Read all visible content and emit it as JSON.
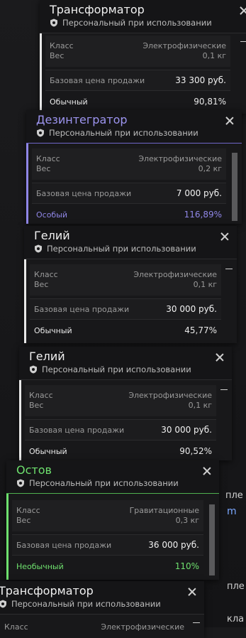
{
  "cards": [
    {
      "title": "Трансформатор",
      "subtitle": "Персональный при использовании",
      "class_label": "Класс",
      "class_value": "Электрофизические",
      "weight_label": "Вес",
      "weight_value": "0,1 кг",
      "price_label": "Базовая цена продажи",
      "price_value": "33 300 руб.",
      "quality_label": "Обычный",
      "quality_value": "90,81%",
      "accent": "#e8e8e8",
      "quality_color": "#e8e8e8"
    },
    {
      "title": "Дезинтегратор",
      "subtitle": "Персональный при использовании",
      "class_label": "Класс",
      "class_value": "Электрофизические",
      "weight_label": "Вес",
      "weight_value": "0,2 кг",
      "price_label": "Базовая цена продажи",
      "price_value": "7 000 руб.",
      "quality_label": "Особый",
      "quality_value": "116,89%",
      "accent": "#8f86e6",
      "quality_color": "#8f86e6"
    },
    {
      "title": "Гелий",
      "subtitle": "Персональный при использовании",
      "class_label": "Класс",
      "class_value": "Электрофизические",
      "weight_label": "Вес",
      "weight_value": "0,1 кг",
      "price_label": "Базовая цена продажи",
      "price_value": "30 000 руб.",
      "quality_label": "Обычный",
      "quality_value": "45,77%",
      "accent": "#e8e8e8",
      "quality_color": "#e8e8e8"
    },
    {
      "title": "Гелий",
      "subtitle": "Персональный при использовании",
      "class_label": "Класс",
      "class_value": "Электрофизические",
      "weight_label": "Вес",
      "weight_value": "0,1 кг",
      "price_label": "Базовая цена продажи",
      "price_value": "30 000 руб.",
      "quality_label": "Обычный",
      "quality_value": "90,52%",
      "accent": "#e8e8e8",
      "quality_color": "#e8e8e8"
    },
    {
      "title": "Остов",
      "subtitle": "Персональный при использовании",
      "class_label": "Класс",
      "class_value": "Гравитационные",
      "weight_label": "Вес",
      "weight_value": "0,3 кг",
      "price_label": "Базовая цена продажи",
      "price_value": "36 000 руб.",
      "quality_label": "Необычный",
      "quality_value": "110%",
      "accent": "#6ee06e",
      "quality_color": "#6ee06e"
    },
    {
      "title": "Трансформатор",
      "subtitle": "Персональный при использовании",
      "class_label": "Класс",
      "class_value": "Электрофизические",
      "accent": "#e8e8e8"
    }
  ],
  "side_fragments": [
    "пле",
    "m",
    "пле",
    "кла"
  ],
  "colors": {
    "bg": "#1a1a1c",
    "card": "#18181a"
  }
}
